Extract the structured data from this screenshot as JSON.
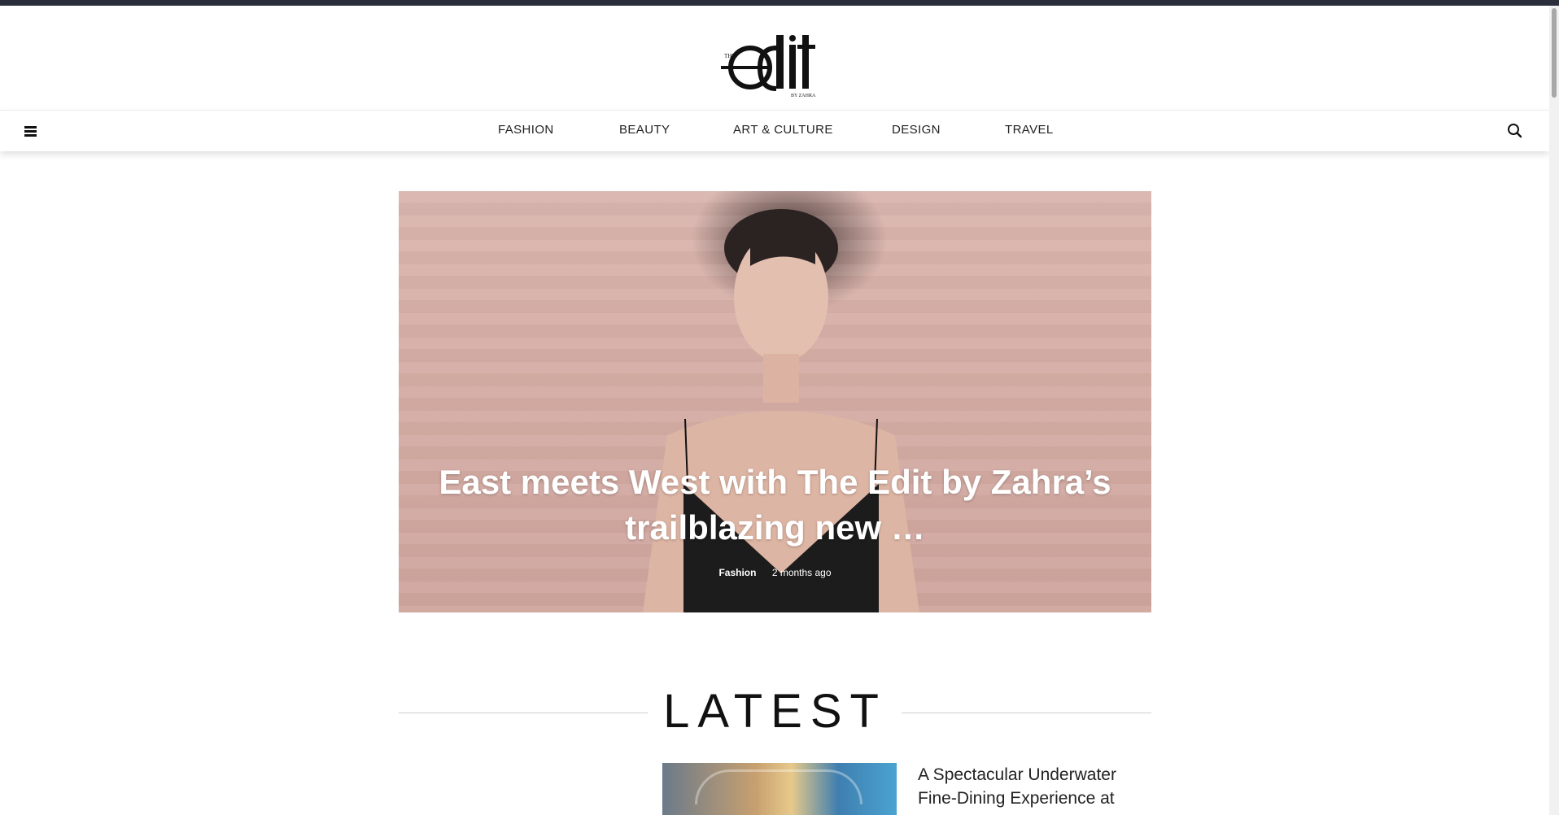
{
  "site": {
    "logo_alt": "The Edit by Zahra",
    "logo_small_top": "THE",
    "logo_main": "edit",
    "logo_small_bottom": "BY ZAHRA"
  },
  "nav": {
    "items": [
      {
        "label": "FASHION"
      },
      {
        "label": "BEAUTY"
      },
      {
        "label": "ART & CULTURE"
      },
      {
        "label": "DESIGN"
      },
      {
        "label": "TRAVEL"
      }
    ],
    "menu_icon": "hamburger-icon",
    "search_icon": "search-icon"
  },
  "hero": {
    "title": "East meets West with The Edit by Zahra’s trailblazing new …",
    "category": "Fashion",
    "date": "2 months ago"
  },
  "latest": {
    "heading": "LATEST"
  },
  "articles": [
    {
      "title": "A Spectacular Underwater Fine-Dining Experience at"
    }
  ],
  "colors": {
    "topbar": "#2a2d3a",
    "background": "#ffffff",
    "text": "#222222"
  }
}
